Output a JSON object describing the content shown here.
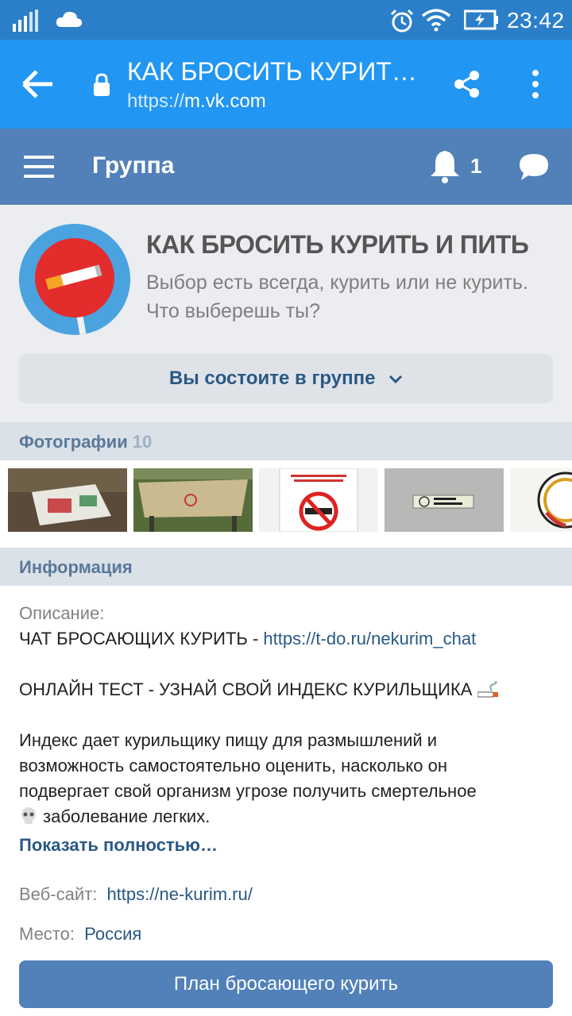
{
  "status_bar": {
    "time": "23:42",
    "icons": [
      "signal-icon",
      "cloud-icon",
      "alarm-icon",
      "wifi-icon",
      "battery-charging-icon"
    ]
  },
  "browser": {
    "title": "КАК БРОСИТЬ КУРИТ…",
    "url_scheme": "https://",
    "url_host": "m.vk.com"
  },
  "vk_header": {
    "label": "Группа",
    "notifications": "1"
  },
  "group": {
    "title": "КАК БРОСИТЬ КУРИТЬ И ПИТЬ",
    "status": "Выбор есть всегда, курить или не курить. Что выберешь ты?",
    "member_button": "Вы состоите в группе"
  },
  "photos": {
    "header": "Фотографии",
    "count": "10"
  },
  "info": {
    "header": "Информация",
    "description_label": "Описание:",
    "chat_text": "ЧАТ БРОСАЮЩИХ КУРИТЬ - ",
    "chat_link": "https://t-do.ru/nekurim_chat",
    "test_text": "ОНЛАЙН ТЕСТ - УЗНАЙ СВОЙ ИНДЕКС КУРИЛЬЩИКА",
    "para_line1": "Индекс дает курильщику пищу для размышлений и",
    "para_line2": "возможность самостоятельно оценить, насколько он",
    "para_line3": "подвергает свой организм угрозе получить смертельное",
    "para_line4": "заболевание легких.",
    "show_more": "Показать полностью…",
    "website_label": "Веб-сайт:",
    "website_link": "https://ne-kurim.ru/",
    "place_label": "Место:",
    "place_value": "Россия",
    "plan_button": "План бросающего курить"
  },
  "colors": {
    "status_bar": "#2b7fc9",
    "browser_bar": "#2196f3",
    "vk_header": "#5181b8",
    "link": "#2a5885"
  }
}
